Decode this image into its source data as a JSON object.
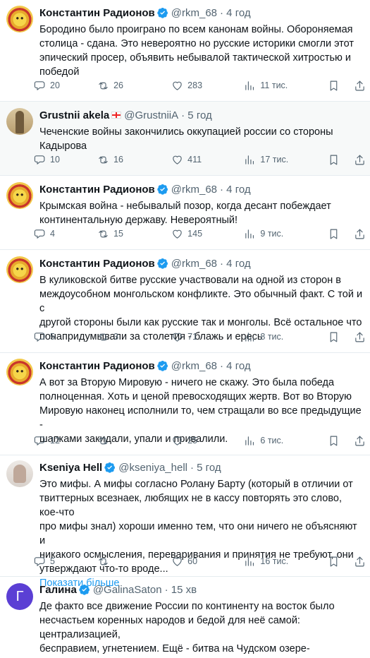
{
  "tweets": [
    {
      "name": "Константин Радионов",
      "handle": "@rkm_68",
      "time": "· 4 год",
      "text": "Бородино было проиграно по всем канонам войны. Обороняемая\nстолица - сдана. Это невероятно но русские историки смогли этот\nэпический просер, объявить небывалой тактической хитростью и\nпобедой",
      "replies": "20",
      "retweets": "26",
      "likes": "283",
      "views": "11 тис."
    },
    {
      "name": "Grustnii akela",
      "handle": "@GrustniiA",
      "time": "· 5 год",
      "text": "Чеченские войны закончились оккупацией россии со стороны\nКадырова",
      "replies": "10",
      "retweets": "16",
      "likes": "411",
      "views": "17 тис."
    },
    {
      "name": "Константин Радионов",
      "handle": "@rkm_68",
      "time": "· 4 год",
      "text": "Крымская война - небывалый позор, когда десант побеждает\nконтинентальную державу. Невероятный!",
      "replies": "4",
      "retweets": "15",
      "likes": "145",
      "views": "9 тис."
    },
    {
      "name": "Константин Радионов",
      "handle": "@rkm_68",
      "time": "· 4 год",
      "text": "В куликовской битве русские участвовали на одной из сторон в\nмеждоусобном монгольском конфликте. Это обычный факт. С той и с\nдругой стороны были как русские так и монголы. Всё остальное что\nпонапридумывали за столетия - блажь и ересь",
      "replies": "5",
      "retweets": "3",
      "likes": "71",
      "views": "8 тис."
    },
    {
      "name": "Константин Радионов",
      "handle": "@rkm_68",
      "time": "· 4 год",
      "text": "А вот за Вторую Мировую - ничего не скажу. Это была победа\nполноценная. Хоть и ценой превосходящих жертв. Вот во Вторую\nМировую наконец исполнили то, чем стращали во все предыдущие -\nшапками закидали, упали и привалили.",
      "replies": "12",
      "retweets": "",
      "likes": "25",
      "views": "6 тис."
    },
    {
      "name": "Kseniya Hell",
      "handle": "@kseniya_hell",
      "time": "· 5 год",
      "text": "Это мифы. А мифы согласно Ролану Барту (который в отличии от\nтвиттерных всезнаек, любящих не в кассу повторять это слово, кое-что\nпро мифы знал) хороши именно тем, что они ничего не объясняют и\nникакого осмысления, переваривания и принятия не требуют, они\nутверждают что-то вроде...",
      "more": "Показати більше",
      "replies": "5",
      "retweets": "",
      "likes": "60",
      "views": "16 тис."
    },
    {
      "name": "Галина",
      "handle": "@GalinaSaton",
      "time": "· 15 хв",
      "avatar_letter": "Г",
      "text": "Де факто все движение России по континенту на восток было\nнесчастьем коренных народов и бедой для неё самой: централизацией,\nбесправием, угнетением.  Ещё - битва на Чудском озере- мифологема,\nа война с Японией- катастрофа."
    }
  ],
  "colors": {
    "accent": "#1d9bf0",
    "muted": "#536471",
    "text": "#0f1419",
    "divider": "#e6ecf0"
  },
  "icons": [
    "reply-icon",
    "retweet-icon",
    "like-icon",
    "views-icon",
    "bookmark-icon",
    "share-icon",
    "verified-badge-icon",
    "georgia-flag-icon"
  ]
}
